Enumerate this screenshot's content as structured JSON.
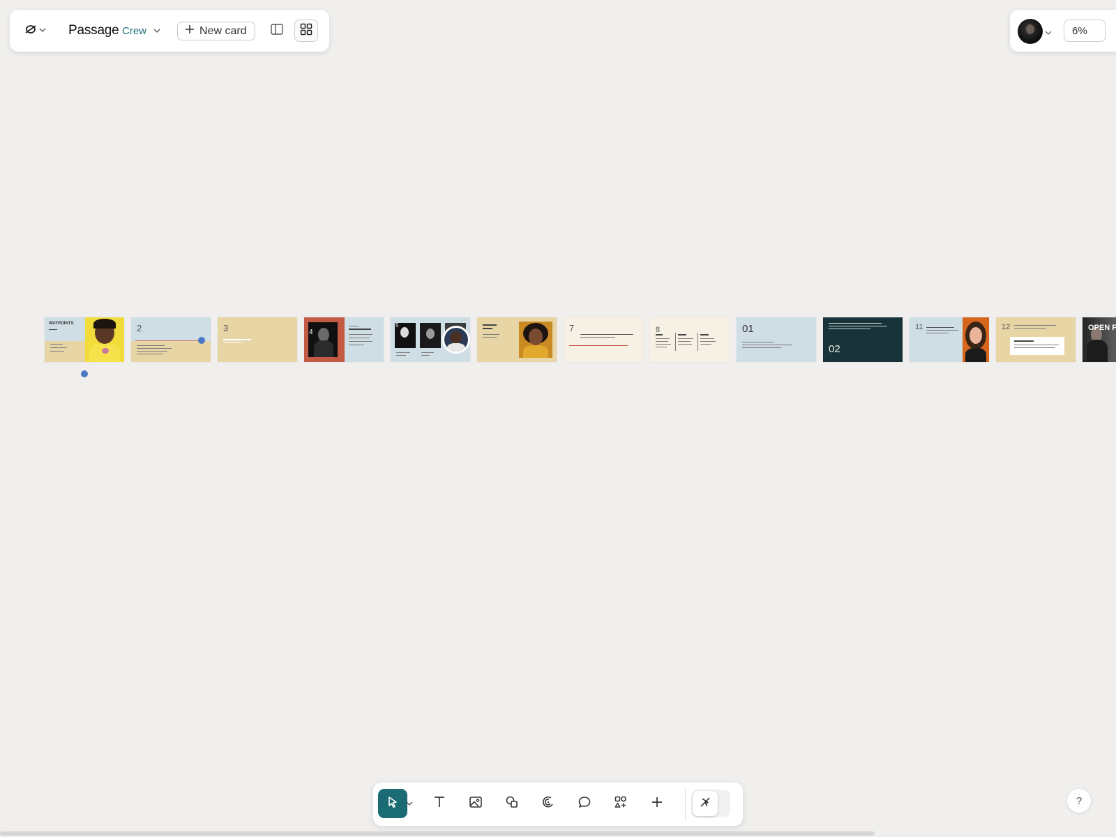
{
  "toolbar": {
    "doc_title": "Passage",
    "workspace": "Crew",
    "new_card_label": "New card",
    "icons": {
      "logo": "shape-logo-icon",
      "logo_chevron": "chevron-down-icon",
      "workspace_chevron": "chevron-down-icon",
      "new_card": "plus-icon",
      "panel_view": "panel-view-icon",
      "grid_view": "grid-view-icon"
    }
  },
  "topright": {
    "zoom": "6%",
    "avatar_chevron": "chevron-down-icon"
  },
  "slides": [
    {
      "num": "",
      "title": "WAYPOINTS",
      "bg": "#e8d5a6"
    },
    {
      "num": "2",
      "bg": "#cfdde4"
    },
    {
      "num": "3",
      "bg": "#e8d5a6"
    },
    {
      "num": "4",
      "bg": "#c35a44"
    },
    {
      "num": "5",
      "bg": "#cfdde4"
    },
    {
      "num": "",
      "bg": "#e8d5a6"
    },
    {
      "num": "7",
      "bg": "#f6f1e4"
    },
    {
      "num": "8",
      "bg": "#f6f1e4"
    },
    {
      "num": "01",
      "bg": "#cfdde4"
    },
    {
      "num": "02",
      "bg": "#18333a"
    },
    {
      "num": "11",
      "bg": "#cfdde4"
    },
    {
      "num": "12",
      "bg": "#e8d5a6"
    },
    {
      "num": "",
      "title": "OPEN FL",
      "bg": "#3a3a3a"
    }
  ],
  "dock": {
    "tools": [
      {
        "name": "select-tool",
        "icon": "arrow-pointer-icon",
        "active": true
      },
      {
        "name": "text-tool",
        "icon": "text-icon"
      },
      {
        "name": "image-tool",
        "icon": "image-icon"
      },
      {
        "name": "shapes-tool",
        "icon": "shapes-icon"
      },
      {
        "name": "pen-tool",
        "icon": "pen-icon"
      },
      {
        "name": "comment-tool",
        "icon": "comment-icon"
      },
      {
        "name": "components-tool",
        "icon": "components-icon"
      },
      {
        "name": "add-tool",
        "icon": "plus-icon"
      }
    ],
    "toggle_icon": "pointer-off-icon"
  },
  "help_label": "?",
  "colors": {
    "accent": "#1a6b73",
    "workspace_text": "#1f6f7a",
    "canvas": "#f0efed",
    "cursor_dot": "#4a78c4"
  }
}
